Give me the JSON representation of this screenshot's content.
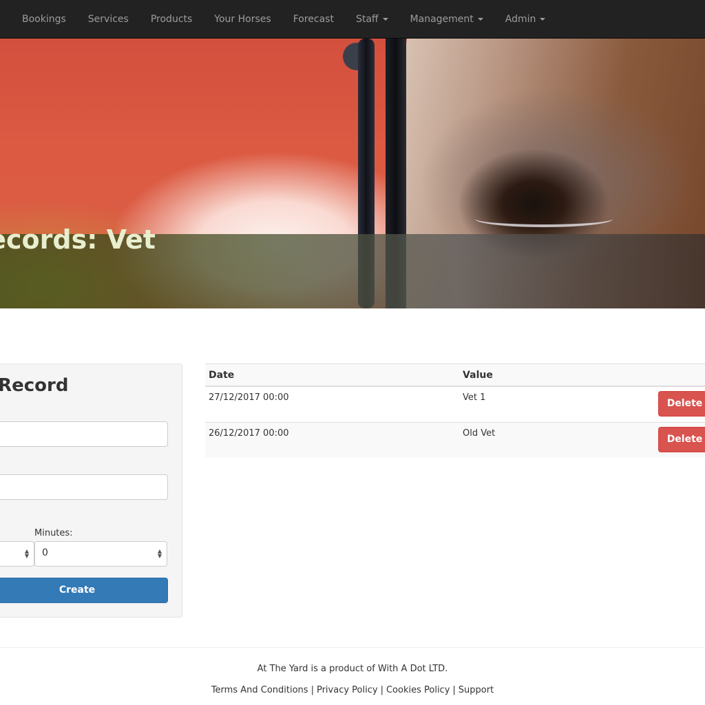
{
  "navbar": {
    "items": [
      {
        "label": "Bookings",
        "dropdown": false
      },
      {
        "label": "Services",
        "dropdown": false
      },
      {
        "label": "Products",
        "dropdown": false
      },
      {
        "label": "Your Horses",
        "dropdown": false
      },
      {
        "label": "Forecast",
        "dropdown": false
      },
      {
        "label": "Staff",
        "dropdown": true
      },
      {
        "label": "Management",
        "dropdown": true
      },
      {
        "label": "Admin",
        "dropdown": true
      }
    ]
  },
  "hero": {
    "title": "Records: Vet"
  },
  "form": {
    "title": "w Record",
    "field1_value": "",
    "field2_value": "",
    "hours_select_value": "",
    "minutes_label": "Minutes:",
    "minutes_select_value": "0",
    "create_label": "Create"
  },
  "table": {
    "columns": [
      "Date",
      "Value",
      ""
    ],
    "rows": [
      {
        "date": "27/12/2017 00:00",
        "value": "Vet 1",
        "action": "Delete"
      },
      {
        "date": "26/12/2017 00:00",
        "value": "Old Vet",
        "action": "Delete"
      }
    ]
  },
  "footer": {
    "tagline": "At The Yard is a product of With A Dot LTD.",
    "links": [
      "Terms And Conditions",
      "Privacy Policy",
      "Cookies Policy",
      "Support"
    ],
    "separator": "|"
  },
  "colors": {
    "navbar_bg": "#222222",
    "nav_text": "#9d9d9d",
    "primary": "#337ab7",
    "danger": "#d9534f",
    "title_text": "#e7efcf"
  }
}
